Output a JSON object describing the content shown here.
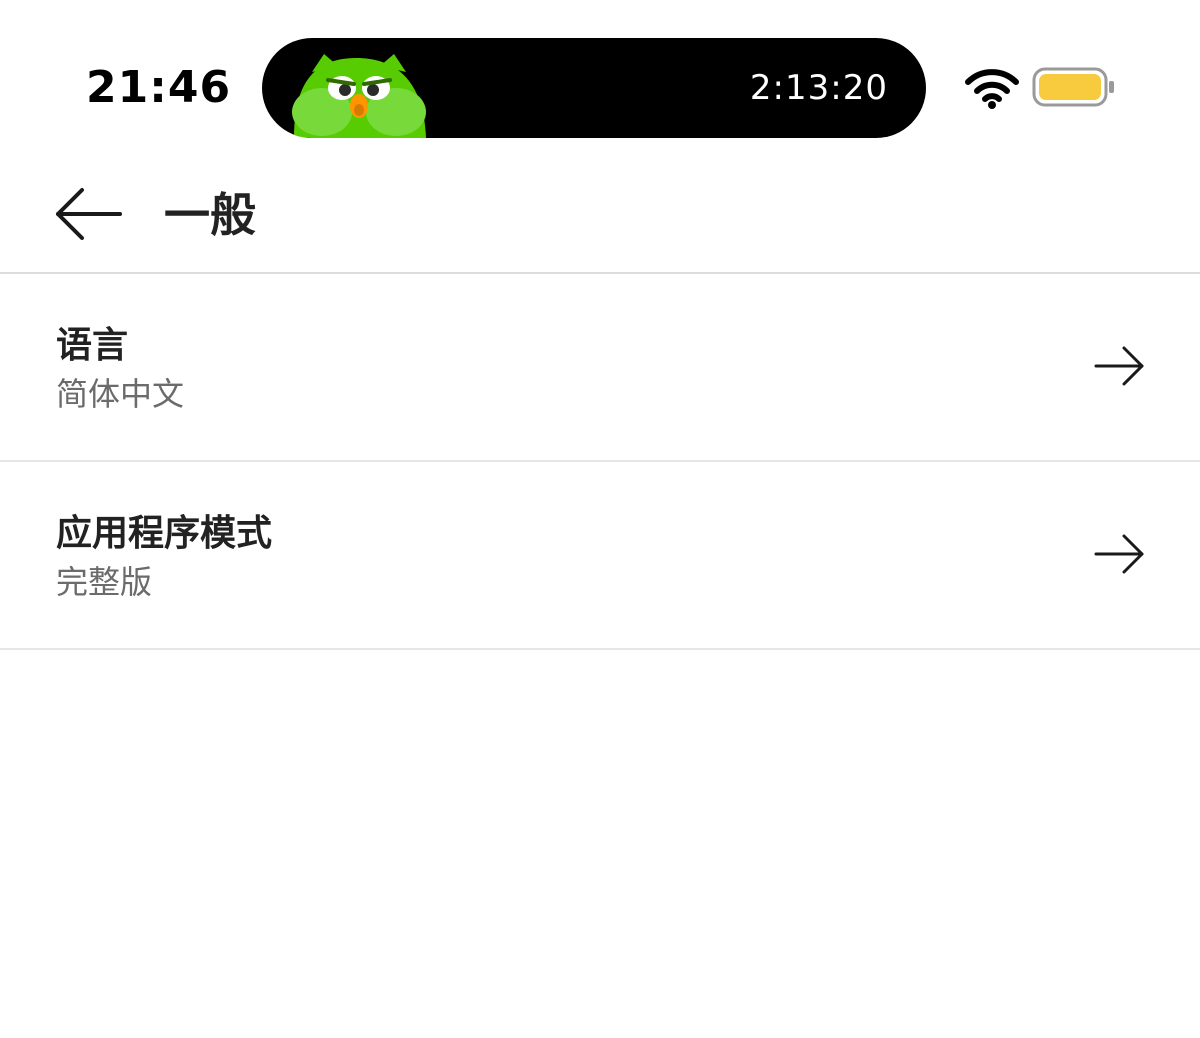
{
  "status_bar": {
    "time": "21:46",
    "live_activity_timer": "2:13:20",
    "battery_color": "#f7cb3d"
  },
  "nav": {
    "title": "一般",
    "back_icon": "arrow-left-icon"
  },
  "settings": {
    "items": [
      {
        "title": "语言",
        "value": "简体中文",
        "icon": "arrow-right-icon"
      },
      {
        "title": "应用程序模式",
        "value": "完整版",
        "icon": "arrow-right-icon"
      }
    ]
  },
  "colors": {
    "owl_green": "#58cc02",
    "owl_beak": "#ff9600",
    "divider": "#dcdcdc",
    "secondary_text": "#6b6b6b"
  }
}
